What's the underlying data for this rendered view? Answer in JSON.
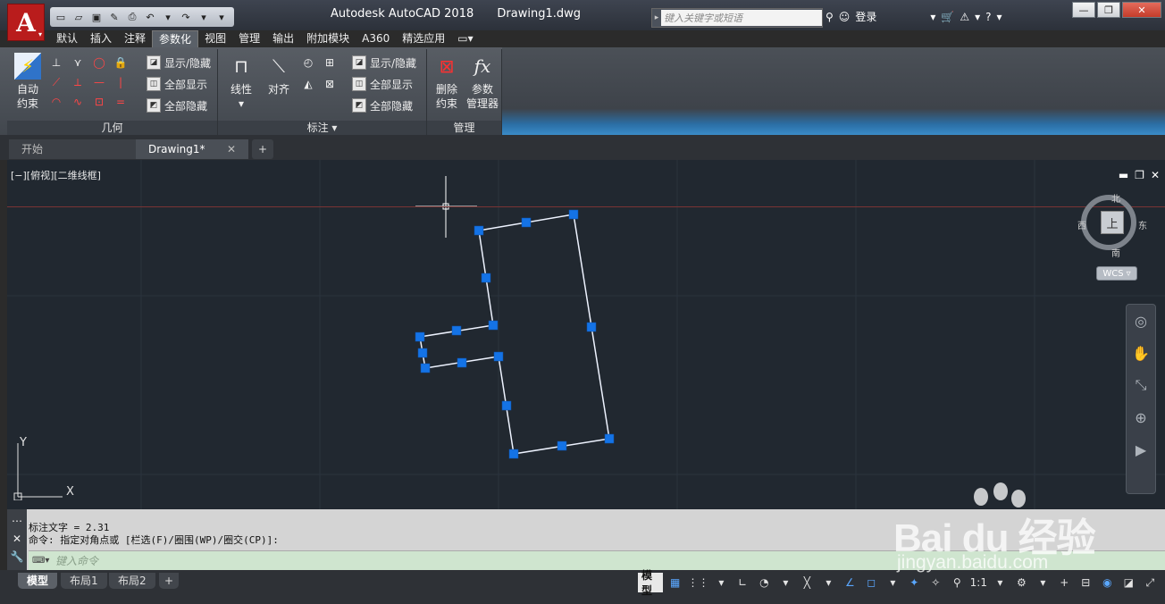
{
  "app": {
    "logo_letter": "A",
    "title": "Autodesk AutoCAD 2018",
    "filename": "Drawing1.dwg",
    "search_placeholder": "键入关键字或短语",
    "login_label": "登录",
    "help_label": "?"
  },
  "ribbon_tabs": [
    {
      "label": "默认",
      "active": false
    },
    {
      "label": "插入",
      "active": false
    },
    {
      "label": "注释",
      "active": false
    },
    {
      "label": "参数化",
      "active": true
    },
    {
      "label": "视图",
      "active": false
    },
    {
      "label": "管理",
      "active": false
    },
    {
      "label": "输出",
      "active": false
    },
    {
      "label": "附加模块",
      "active": false
    },
    {
      "label": "A360",
      "active": false
    },
    {
      "label": "精选应用",
      "active": false
    }
  ],
  "panels": {
    "geometry": {
      "title": "几何",
      "auto_constrain_label_1": "自动",
      "auto_constrain_label_2": "约束",
      "show_hide": "显示/隐藏",
      "show_all": "全部显示",
      "hide_all": "全部隐藏"
    },
    "dimension": {
      "title": "标注 ▾",
      "linear": "线性",
      "aligned": "对齐",
      "show_hide": "显示/隐藏",
      "show_all": "全部显示",
      "hide_all": "全部隐藏"
    },
    "manage": {
      "title": "管理",
      "delete_label_1": "删除",
      "delete_label_2": "约束",
      "params_label_1": "参数",
      "params_label_2": "管理器"
    }
  },
  "file_tabs": {
    "start": "开始",
    "drawing": "Drawing1*"
  },
  "viewport": {
    "label": "[−][俯视][二维线框]",
    "compass": {
      "north": "北",
      "south": "南",
      "east": "东",
      "west": "西",
      "top": "上"
    },
    "wcs": "WCS",
    "ucs_x": "X",
    "ucs_y": "Y"
  },
  "command": {
    "history_1": "标注文字 = 2.31",
    "history_2": "命令: 指定对角点或 [栏选(F)/圈围(WP)/圈交(CP)]:",
    "input_placeholder": "键入命令"
  },
  "layout_tabs": {
    "model": "模型",
    "layout1": "布局1",
    "layout2": "布局2"
  },
  "statusbar": {
    "model": "模型",
    "scale": "1:1"
  },
  "watermark": {
    "logo": "Bai du 经验",
    "url": "jingyan.baidu.com"
  },
  "colors": {
    "canvas": "#212830",
    "grip": "#1473e6",
    "polyline": "#eef3ff",
    "accent_red": "#b91c1c"
  }
}
